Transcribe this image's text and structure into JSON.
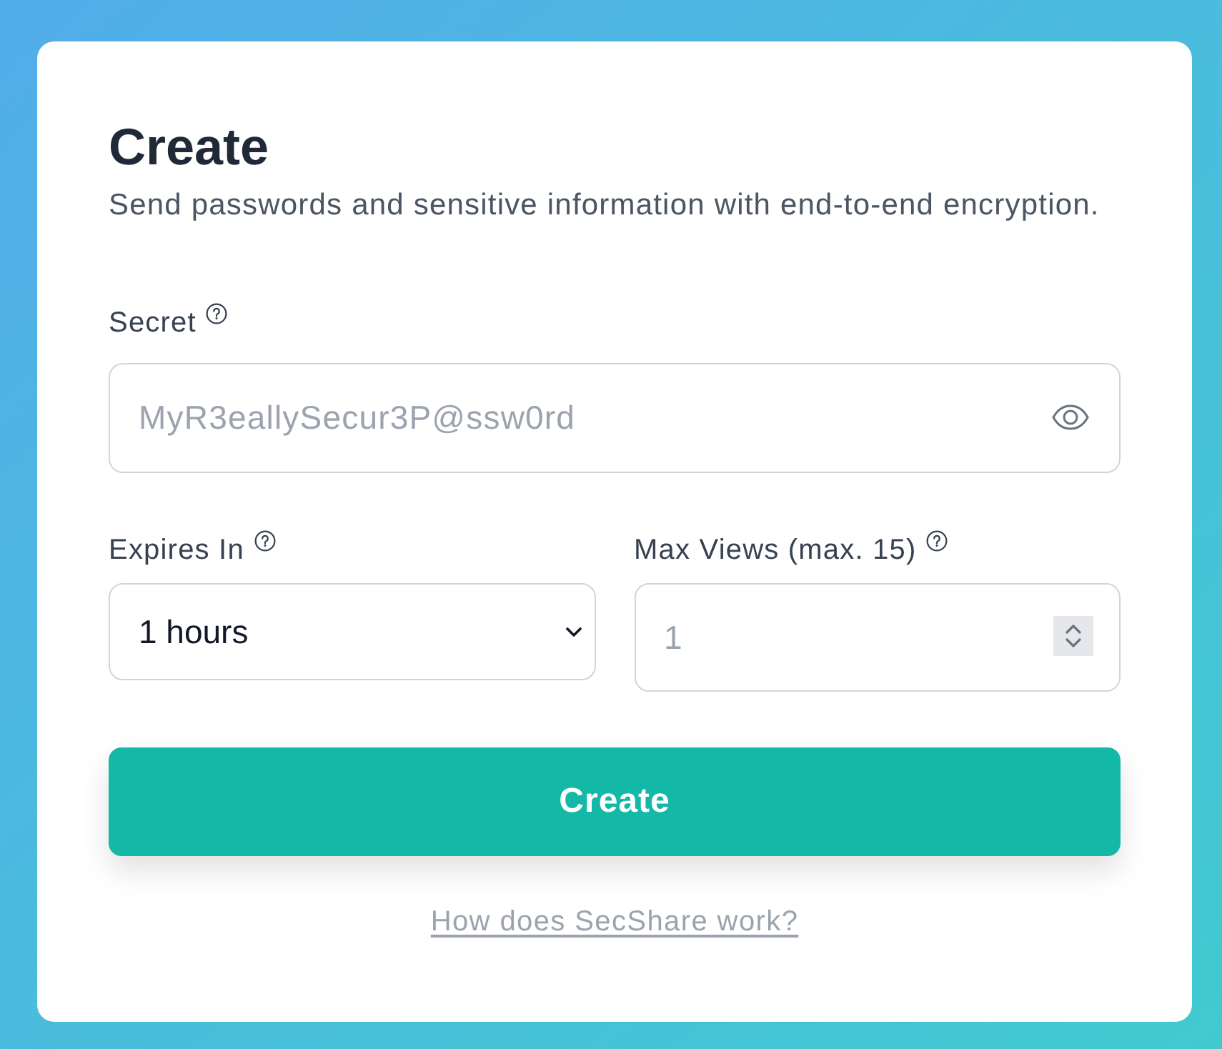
{
  "header": {
    "title": "Create",
    "subtitle": "Send passwords and sensitive information with end-to-end encryption."
  },
  "secret": {
    "label": "Secret",
    "placeholder": "MyR3eallySecur3P@ssw0rd"
  },
  "options": [
    {
      "kind": "select",
      "label": "Expires In",
      "value": "1 hours"
    },
    {
      "kind": "number",
      "label": "Max Views (max. 15)",
      "placeholder": "1"
    }
  ],
  "submit_button": {
    "label": "Create"
  },
  "help_link": {
    "label": "How does SecShare work?"
  }
}
